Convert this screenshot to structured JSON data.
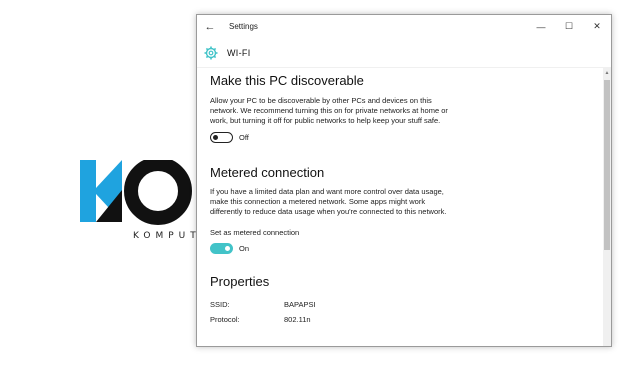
{
  "background": {
    "logo_sub": "KOMPUT"
  },
  "window": {
    "title": "Settings",
    "page_title": "WI-FI",
    "controls": {
      "minimize": "—",
      "maximize": "☐",
      "close": "✕"
    }
  },
  "discoverable": {
    "heading": "Make this PC discoverable",
    "description": "Allow your PC to be discoverable by other PCs and devices on this network. We recommend turning this on for private networks at home or work, but turning it off for public networks to help keep your stuff safe.",
    "toggle_label": "Off",
    "enabled": false
  },
  "metered": {
    "heading": "Metered connection",
    "description": "If you have a limited data plan and want more control over data usage, make this connection a metered network. Some apps might work differently to reduce data usage when you're connected to this network.",
    "set_label": "Set as metered connection",
    "toggle_label": "On",
    "enabled": true
  },
  "properties": {
    "heading": "Properties",
    "rows": [
      {
        "key": "SSID:",
        "value": "BAPAPSI"
      },
      {
        "key": "Protocol:",
        "value": "802.11n"
      }
    ]
  },
  "colors": {
    "accent": "#42c3c8",
    "logo_blue": "#1fa3df"
  },
  "icons": {
    "back": "back-arrow-icon",
    "gear": "gear-icon"
  }
}
